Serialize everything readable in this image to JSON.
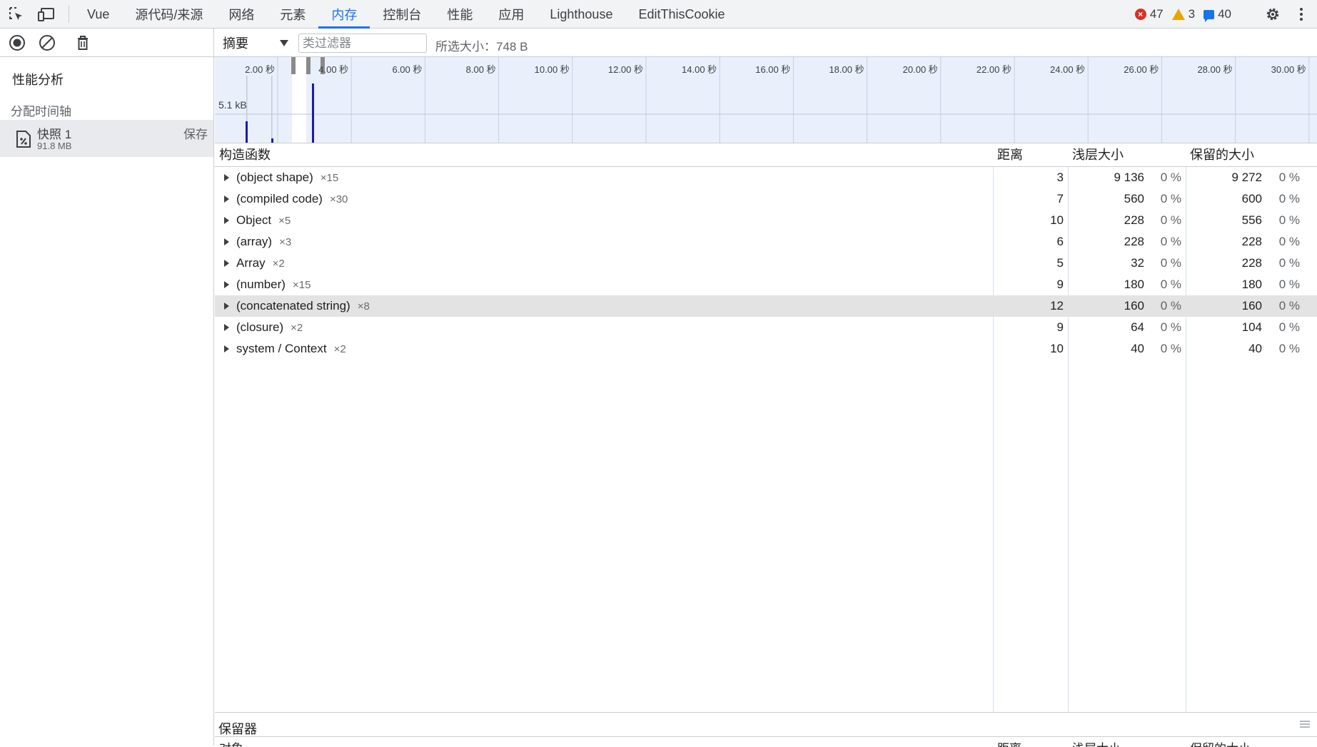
{
  "tabs": [
    {
      "label": "Vue",
      "active": false
    },
    {
      "label": "源代码/来源",
      "active": false
    },
    {
      "label": "网络",
      "active": false
    },
    {
      "label": "元素",
      "active": false
    },
    {
      "label": "内存",
      "active": true
    },
    {
      "label": "控制台",
      "active": false
    },
    {
      "label": "性能",
      "active": false
    },
    {
      "label": "应用",
      "active": false
    },
    {
      "label": "Lighthouse",
      "active": false
    },
    {
      "label": "EditThisCookie",
      "active": false
    }
  ],
  "status": {
    "errors": "47",
    "warnings": "3",
    "messages": "40"
  },
  "sidebar": {
    "section_title": "性能分析",
    "alloc_title": "分配时间轴",
    "snapshot": {
      "name": "快照 1",
      "size": "91.8 MB",
      "save_label": "保存"
    }
  },
  "toolbar": {
    "view": "摘要",
    "filter_placeholder": "类过滤器",
    "selected_size": "所选大小：748 B"
  },
  "timeline": {
    "y_label": "5.1 kB",
    "ticks": [
      "2.00 秒",
      "4.00 秒",
      "6.00 秒",
      "8.00 秒",
      "10.00 秒",
      "12.00 秒",
      "14.00 秒",
      "16.00 秒",
      "18.00 秒",
      "20.00 秒",
      "22.00 秒",
      "24.00 秒",
      "26.00 秒",
      "28.00 秒",
      "30.00 秒"
    ]
  },
  "table": {
    "headers": {
      "constructor": "构造函数",
      "distance": "距离",
      "shallow": "浅层大小",
      "retained": "保留的大小"
    },
    "rows": [
      {
        "name": "(object shape)",
        "count": "×15",
        "distance": "3",
        "shallow": "9 136",
        "shallow_pct": "0 %",
        "retained": "9 272",
        "retained_pct": "0 %"
      },
      {
        "name": "(compiled code)",
        "count": "×30",
        "distance": "7",
        "shallow": "560",
        "shallow_pct": "0 %",
        "retained": "600",
        "retained_pct": "0 %"
      },
      {
        "name": "Object",
        "count": "×5",
        "distance": "10",
        "shallow": "228",
        "shallow_pct": "0 %",
        "retained": "556",
        "retained_pct": "0 %"
      },
      {
        "name": "(array)",
        "count": "×3",
        "distance": "6",
        "shallow": "228",
        "shallow_pct": "0 %",
        "retained": "228",
        "retained_pct": "0 %"
      },
      {
        "name": "Array",
        "count": "×2",
        "distance": "5",
        "shallow": "32",
        "shallow_pct": "0 %",
        "retained": "228",
        "retained_pct": "0 %"
      },
      {
        "name": "(number)",
        "count": "×15",
        "distance": "9",
        "shallow": "180",
        "shallow_pct": "0 %",
        "retained": "180",
        "retained_pct": "0 %"
      },
      {
        "name": "(concatenated string)",
        "count": "×8",
        "distance": "12",
        "shallow": "160",
        "shallow_pct": "0 %",
        "retained": "160",
        "retained_pct": "0 %"
      },
      {
        "name": "(closure)",
        "count": "×2",
        "distance": "9",
        "shallow": "64",
        "shallow_pct": "0 %",
        "retained": "104",
        "retained_pct": "0 %"
      },
      {
        "name": "system / Context",
        "count": "×2",
        "distance": "10",
        "shallow": "40",
        "shallow_pct": "0 %",
        "retained": "40",
        "retained_pct": "0 %"
      }
    ]
  },
  "retainers": {
    "title": "保留器",
    "headers": {
      "object": "对象",
      "distance": "距离",
      "shallow": "浅层大小",
      "retained": "保留的大小"
    }
  }
}
